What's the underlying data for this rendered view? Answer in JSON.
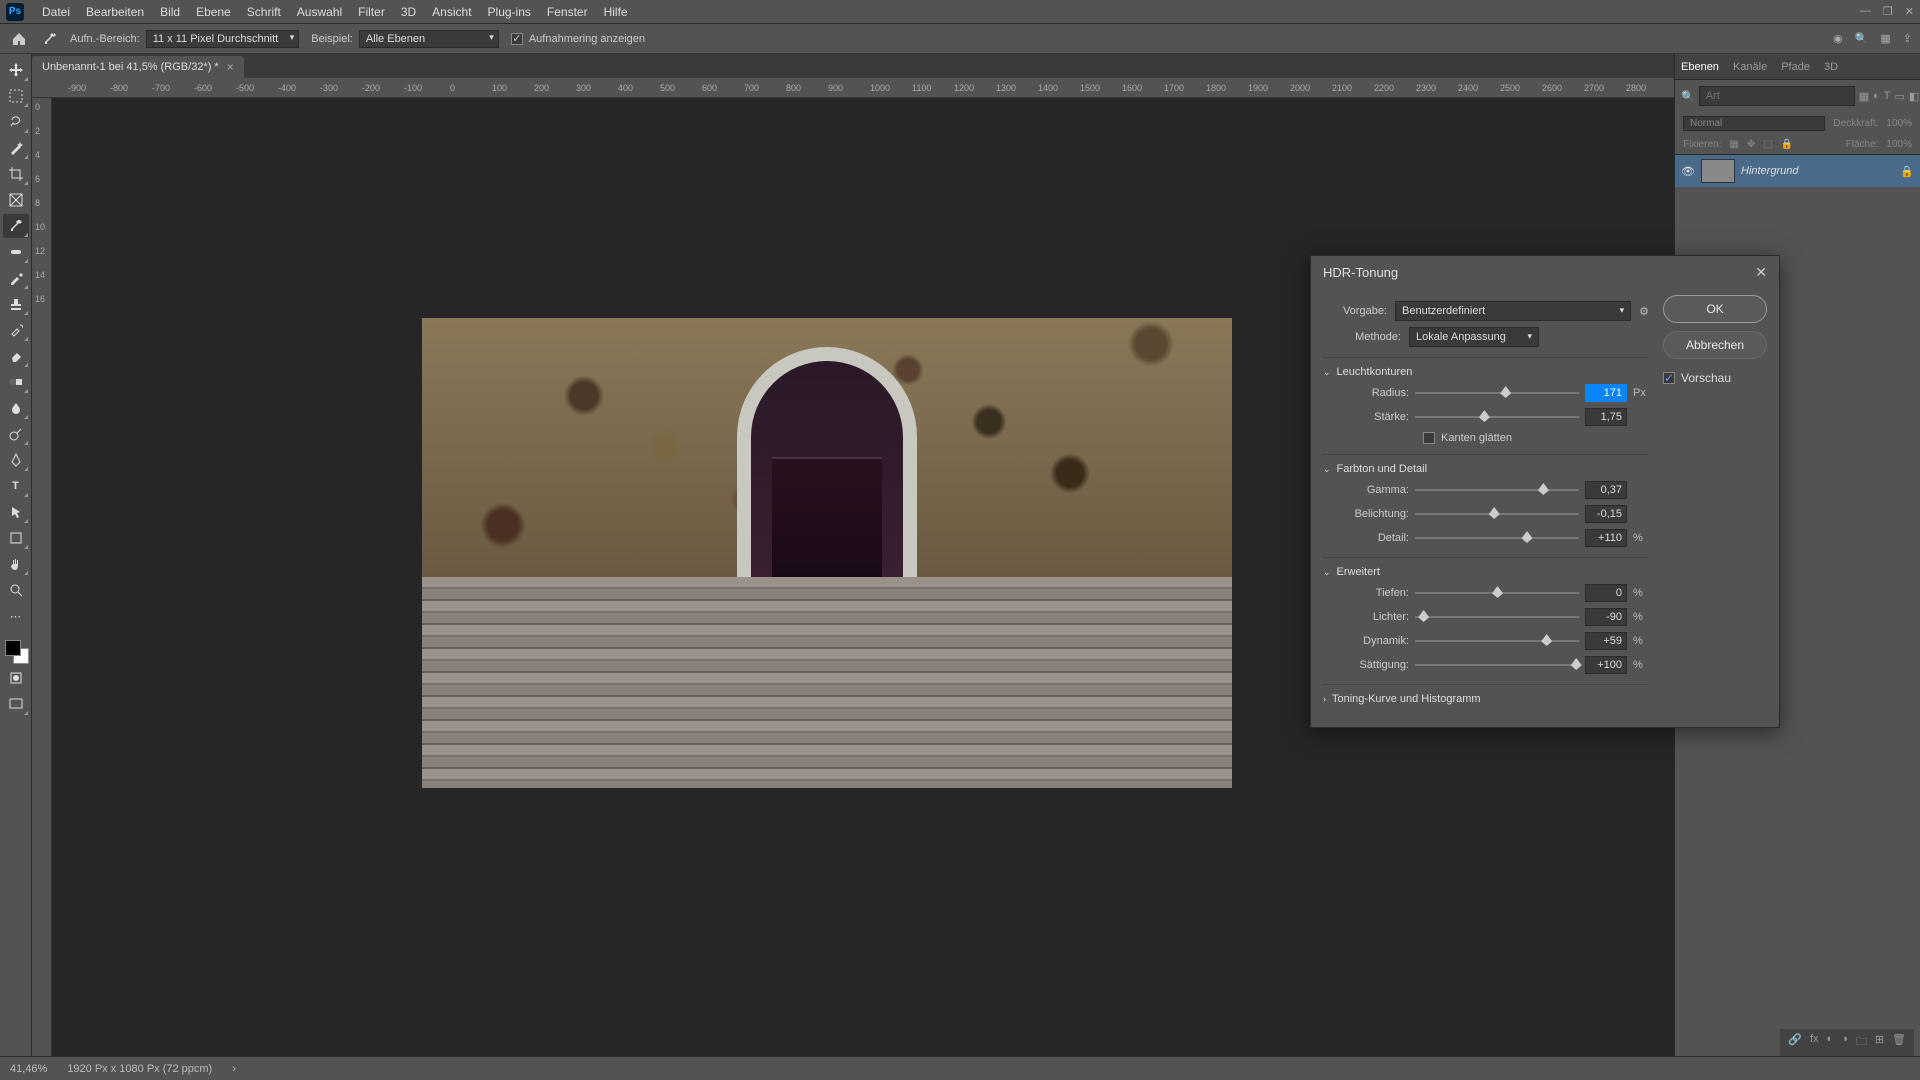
{
  "menubar": {
    "items": [
      "Datei",
      "Bearbeiten",
      "Bild",
      "Ebene",
      "Schrift",
      "Auswahl",
      "Filter",
      "3D",
      "Ansicht",
      "Plug-ins",
      "Fenster",
      "Hilfe"
    ],
    "logo": "Ps"
  },
  "optbar": {
    "sample_label": "Aufn.-Bereich:",
    "sample_value": "11 x 11 Pixel Durchschnitt",
    "layers_label": "Beispiel:",
    "layers_value": "Alle Ebenen",
    "show_label": "Aufnahmering anzeigen"
  },
  "doc": {
    "title": "Unbenannt-1 bei 41,5% (RGB/32*) *"
  },
  "ruler_h": [
    "-900",
    "-800",
    "-700",
    "-600",
    "-500",
    "-400",
    "-300",
    "-200",
    "-100",
    "0",
    "100",
    "200",
    "300",
    "400",
    "500",
    "600",
    "700",
    "800",
    "900",
    "1000",
    "1100",
    "1200",
    "1300",
    "1400",
    "1500",
    "1600",
    "1700",
    "1800",
    "1900",
    "2000",
    "2100",
    "2200",
    "2300",
    "2400",
    "2500",
    "2600",
    "2700",
    "2800"
  ],
  "ruler_v": [
    "0",
    "2",
    "4",
    "6",
    "8",
    "10",
    "12",
    "14",
    "16"
  ],
  "panels": {
    "tabs": [
      "Ebenen",
      "Kanäle",
      "Pfade",
      "3D"
    ],
    "search_ph": "Art",
    "blend": "Normal",
    "opacity_label": "Deckkraft:",
    "opacity_val": "100%",
    "lock_label": "Fixieren:",
    "fill_label": "Fläche:",
    "fill_val": "100%",
    "layer_name": "Hintergrund"
  },
  "status": {
    "zoom": "41,46%",
    "doc": "1920 Px x 1080 Px (72 ppcm)"
  },
  "dialog": {
    "title": "HDR-Tonung",
    "preset_label": "Vorgabe:",
    "preset_value": "Benutzerdefiniert",
    "method_label": "Methode:",
    "method_value": "Lokale Anpassung",
    "ok": "OK",
    "cancel": "Abbrechen",
    "preview": "Vorschau",
    "sec_glow": "Leuchtkonturen",
    "radius_label": "Radius:",
    "radius_val": "171",
    "radius_unit": "Px",
    "strength_label": "Stärke:",
    "strength_val": "1,75",
    "smooth": "Kanten glätten",
    "sec_tone": "Farbton und Detail",
    "gamma_label": "Gamma:",
    "gamma_val": "0,37",
    "exposure_label": "Belichtung:",
    "exposure_val": "-0,15",
    "detail_label": "Detail:",
    "detail_val": "+110",
    "pct": "%",
    "sec_adv": "Erweitert",
    "shadow_label": "Tiefen:",
    "shadow_val": "0",
    "highlight_label": "Lichter:",
    "highlight_val": "-90",
    "vibrance_label": "Dynamik:",
    "vibrance_val": "+59",
    "saturation_label": "Sättigung:",
    "saturation_val": "+100",
    "sec_curve": "Toning-Kurve und Histogramm"
  },
  "slider_pos": {
    "radius": 55,
    "strength": 42,
    "gamma": 78,
    "exposure": 48,
    "detail": 68,
    "shadow": 50,
    "highlight": 5,
    "vibrance": 80,
    "saturation": 98
  }
}
